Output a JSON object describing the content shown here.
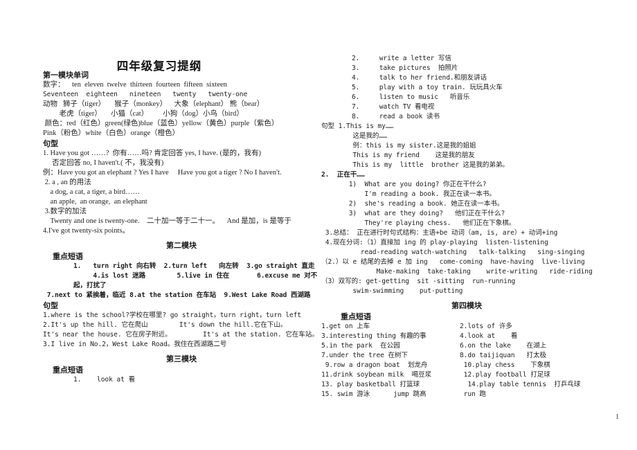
{
  "document": {
    "title": "四年级复习提纲",
    "page_number": "1"
  },
  "left_column": {
    "module1": {
      "heading": "第一模块单词",
      "numbers_label": "数字：",
      "numbers_line1": "数字：    ten  eleven  twelve  thirteen  fourteen  fifteen  sixteen",
      "numbers_line2": "Seventeen  eighteen   nineteen   twenty   twenty-one",
      "animals_label": "动物",
      "animals_line1": "动物   狮子（tiger）     猴子（monkey）    大象（elephant） 熊（bear）",
      "animals_line2": "         老虎（tiger）     小猫（cat）        小狗（dog）小鸟（bird）",
      "colors_line1": " 颜色：red（红色）green(绿色)blue（蓝色）yellow（黄色）purple（紫色）",
      "colors_line2": "Pink（粉色）white（白色）orange（橙色）",
      "sentence_heading": "句型",
      "s1_line1": "1. Have you got ……?  你有……吗? 肯定回答 yes, I have. (是的，我有)",
      "s1_line2": "     否定回答 no, I haven't.( 不，我没有)",
      "s1_example": "例：Have you got an elephant ? Yes I have     Have you got a tiger ? No I haven't.",
      "s2_line1": " 2. a , an 的用法",
      "s2_line2": "    a dog, a cat, a tiger, a bird……",
      "s2_line3": "    an apple,  an orange,  an elephant",
      "s3_line1": " 3.数字的加法",
      "s3_line2": "    Twenty and one is twenty-one.    二十加一等于二十一。    And 是加，is 是等于",
      "s4_line1": "4.I've got twenty-six points。"
    },
    "module2": {
      "heading": "第二模块",
      "phrases_heading": "重点短语",
      "p_line1": "1.   turn right 向右转  2.turn left   向左转  3.go straight 直走",
      "p_line2": "     4.is lost 迷路        5.live in 住在       6.excuse me 对不起，打扰了",
      "p_line3": " 7.next to 紧挨着，临近 8.at the station 在车站  9.West Lake Road 西湖路",
      "sentence_heading": "句型",
      "s_line1": "1.where is the school?学校在哪里? go straight，turn right，turn left",
      "s_line2": "2.It's up the hill. 它在爬山        It's down the hill.它在下山。",
      "s_line3": "It's near the house. 它在房子附近。        It's at the station. 它在车站。",
      "s_line4": "3.I live in No.2，West Lake Road。我住在西湖路二号"
    },
    "module3": {
      "heading": "第三模块",
      "phrases_heading": "重点短语",
      "p_line1": "1.    look at 看"
    }
  },
  "right_column": {
    "module3_phrases": [
      "2.     write a letter 写信",
      "3.     take pictures  拍照片",
      "4.     talk to her friend.和朋友讲话",
      "5.     play with a toy train. 玩玩具火车",
      "6.     listen to music   听音乐",
      "7.     watch TV 看电视",
      "8.     read a book 读书"
    ],
    "sentence_heading": "句型",
    "s1_line1": "句型 1.This is my……",
    "s1_line2": "        这是我的……",
    "s1_line3": "        例：this is my sister.这是我的姐姐",
    "s1_line4": "        This is my friend    这是我的朋友",
    "s1_line5": "        This is my  little  brother 这是我的弟弟。",
    "s2_heading": "2.  正在干……",
    "s2_line1": "       1)  What are you doing? 你正在干什么?",
    "s2_line2": "           I'm reading a book. 我正在读一本书。",
    "s2_line3": "       2)  she's reading a book. 她正在读一本书。",
    "s2_line4": "       3)  what are they doing?   他们正在干什么?",
    "s2_line5": "           They're playing chess.   他们正在下象棋。",
    "s3_line1": " 3.总结： 正在进行时句式结构：主语+be 动词（am, is, are）+ 动词+ing",
    "s4_line1": " 4.现在分词:（1）直接加 ing 的 play-playing  listen-listening",
    "s4_line2": "          read-reading watch-watching   talk-talking   sing-singing",
    "s5_line1": "（2.）以 e 结尾的去掉 e 加 ing   come-coming  have-having  live-living",
    "s5_line2": "              Make-making  take-taking    write-writing   ride-riding",
    "s6_line1": "（3）双写的: get-getting  sit -sitting  run-running",
    "s6_line2": "        swim-swimming    put-putting",
    "module4": {
      "heading": "第四模块",
      "phrases_heading": "重点短语",
      "rows": [
        {
          "left": "1.get on 上车",
          "right": "2.lots of 许多"
        },
        {
          "left": "3.interesting thing 有趣的事",
          "right": "4.look at    看"
        },
        {
          "left": "5.in the park  在公园",
          "right": "6.on the lake    在湖上"
        },
        {
          "left": "7.under the tree 在树下",
          "right": "8.do taijiquan   打太极"
        },
        {
          "left": " 9.row a dragon boat  划龙舟",
          "right": " 10.play chess    下象棋"
        },
        {
          "left": "11.drink soybean milk  喝豆浆",
          "right": " 12.play football 打足球"
        },
        {
          "left": "13. play basketball 打篮球",
          "right": "  14.play table tennis  打乒乓球"
        },
        {
          "left": "15. swim 游泳      jump 跳高",
          "right": " run 跑"
        }
      ]
    }
  }
}
